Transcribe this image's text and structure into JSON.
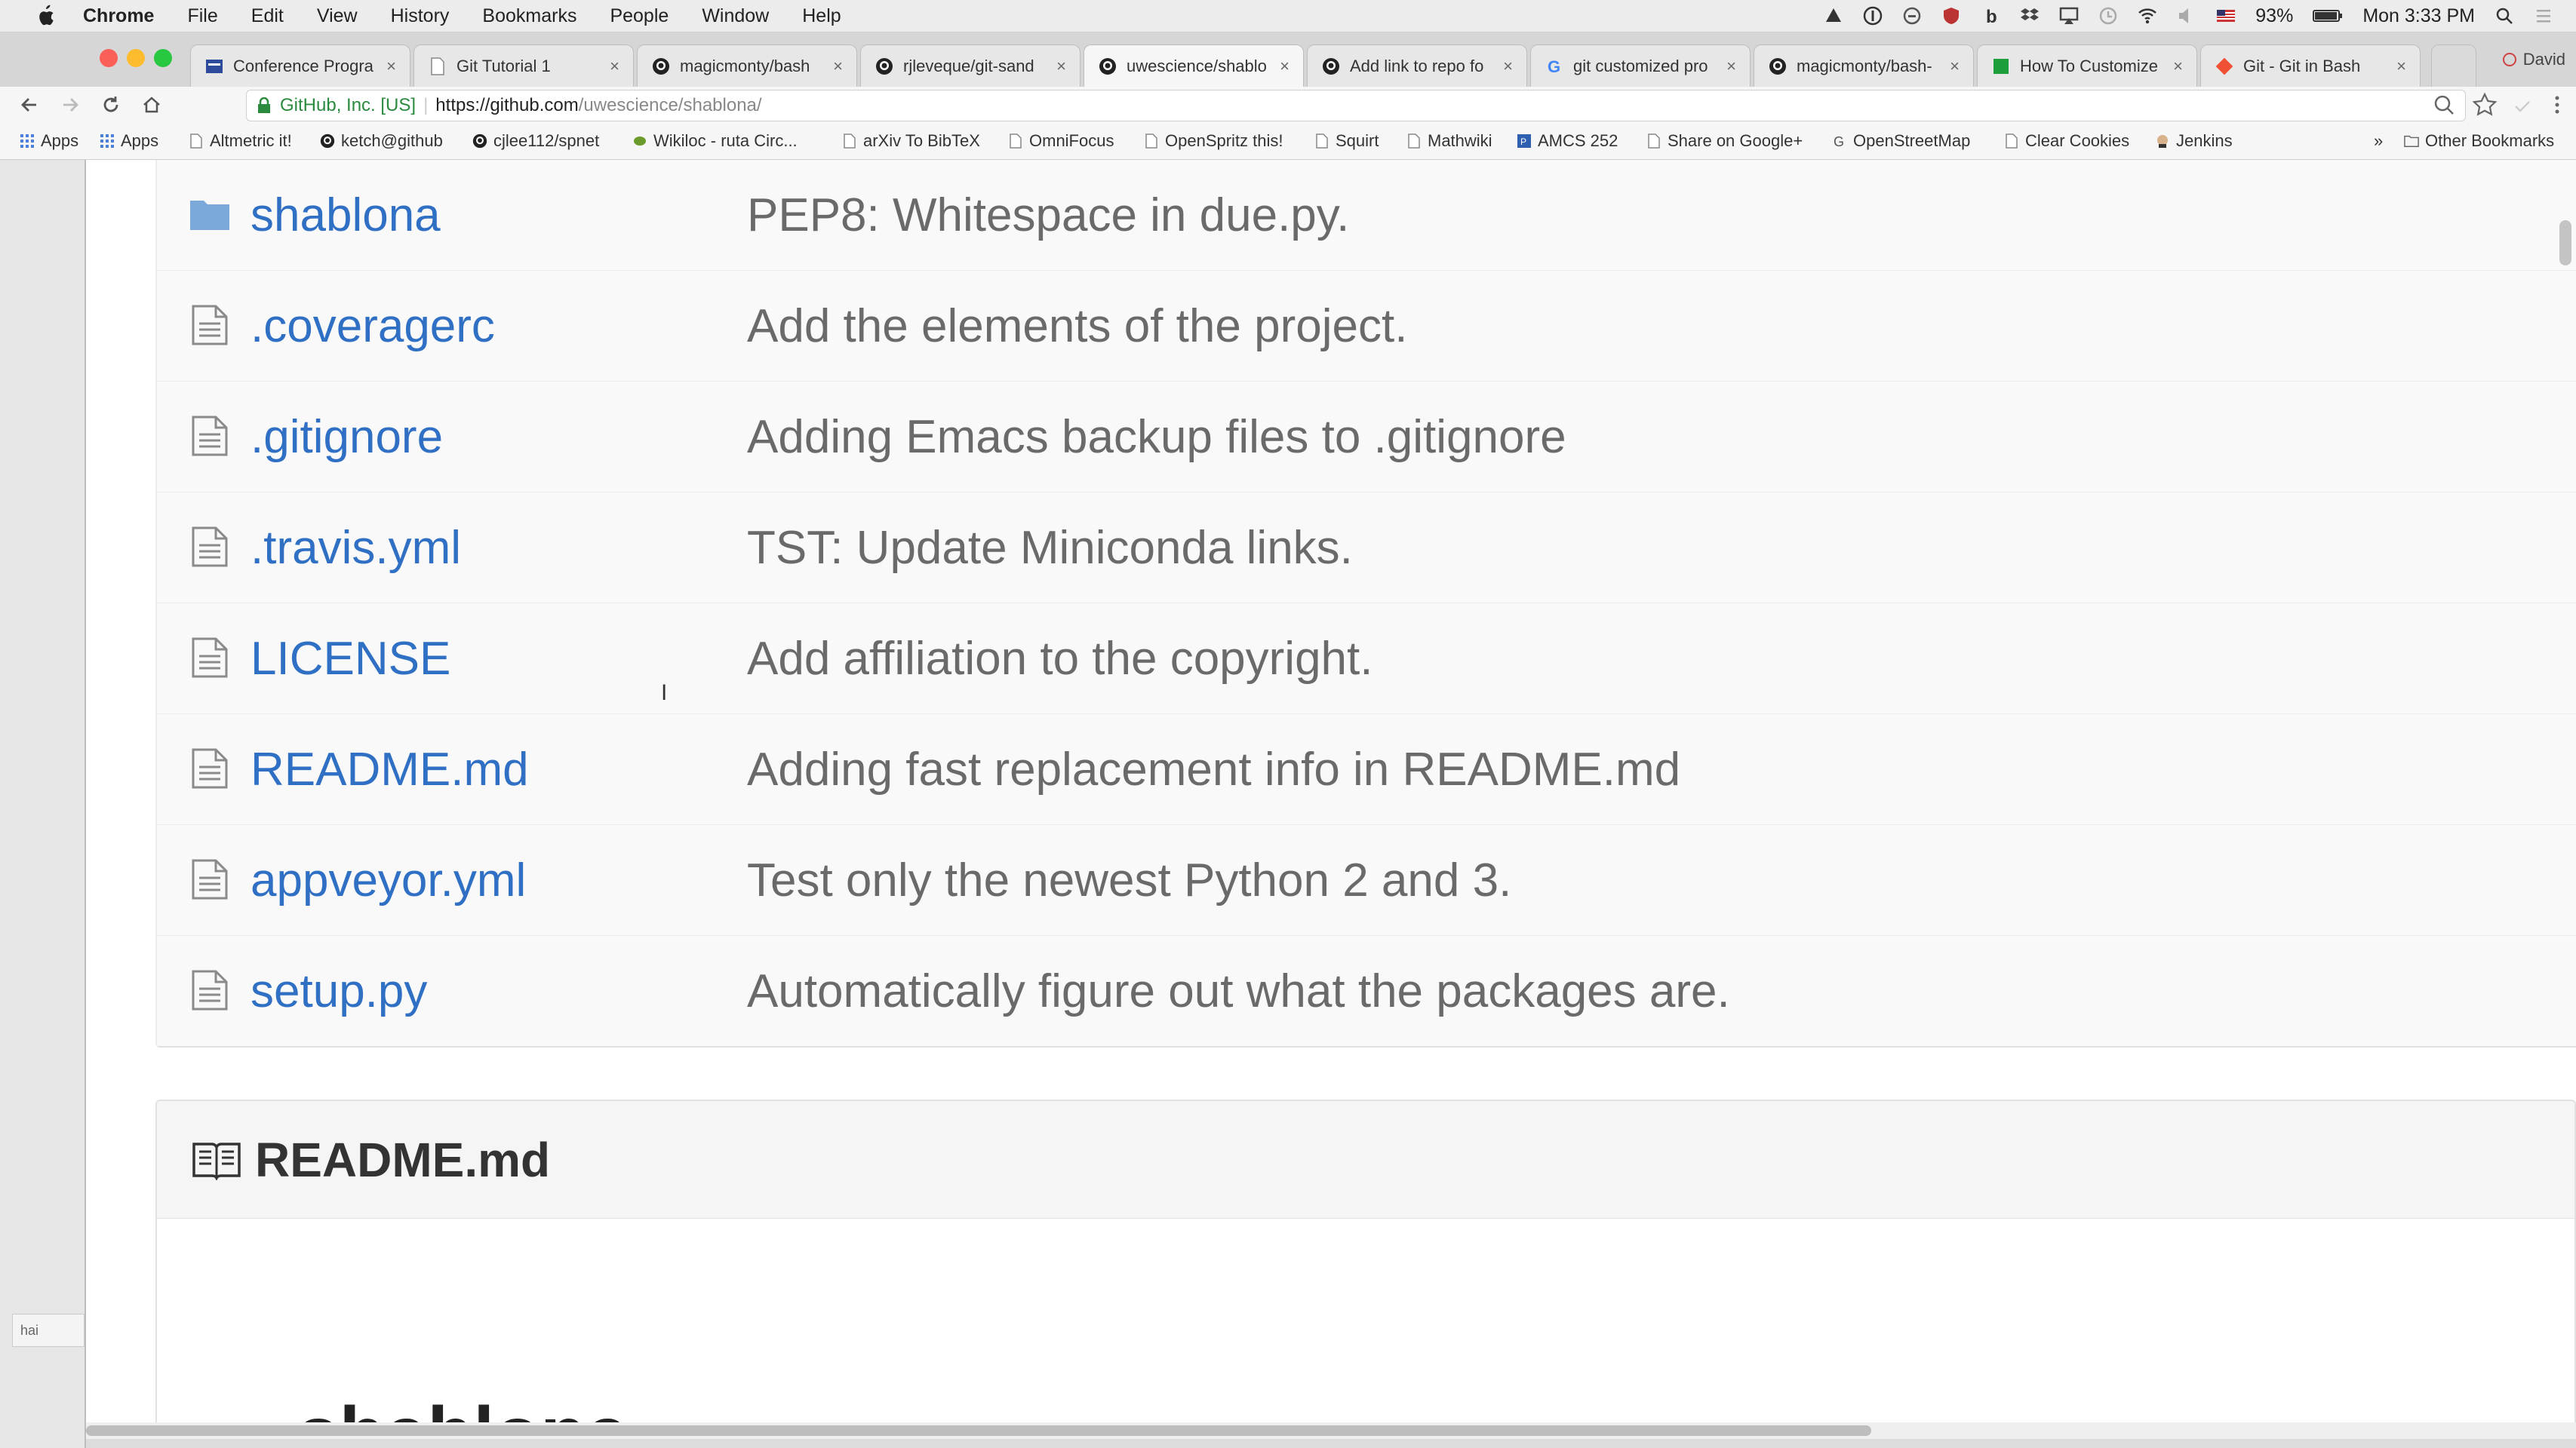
{
  "menubar": {
    "app_name": "Chrome",
    "items": [
      "File",
      "Edit",
      "View",
      "History",
      "Bookmarks",
      "People",
      "Window",
      "Help"
    ],
    "battery": "93%",
    "clock": "Mon 3:33 PM"
  },
  "tabs": [
    {
      "title": "Conference Progra",
      "favicon": "conference-icon"
    },
    {
      "title": "Git Tutorial 1",
      "favicon": "page-icon"
    },
    {
      "title": "magicmonty/bash",
      "favicon": "github-icon"
    },
    {
      "title": "rjleveque/git-sand",
      "favicon": "github-icon"
    },
    {
      "title": "uwescience/shablo",
      "favicon": "github-icon",
      "active": true
    },
    {
      "title": "Add link to repo fo",
      "favicon": "github-icon"
    },
    {
      "title": "git customized pro",
      "favicon": "google-icon"
    },
    {
      "title": "magicmonty/bash-",
      "favicon": "github-icon"
    },
    {
      "title": "How To Customize",
      "favicon": "green-square-icon"
    },
    {
      "title": "Git - Git in Bash",
      "favicon": "git-icon"
    }
  ],
  "profile_name": "David",
  "address": {
    "org": "GitHub, Inc. [US]",
    "url_host": "https://github.com",
    "url_path": "/uwescience/shablona/"
  },
  "bookmarks": {
    "apps_label": "Apps",
    "items": [
      "Apps",
      "Altmetric it!",
      "ketch@github",
      "cjlee112/spnet",
      "Wikiloc - ruta Circ...",
      "arXiv To BibTeX",
      "OmniFocus",
      "OpenSpritz this!",
      "Squirt",
      "Mathwiki",
      "AMCS 252",
      "Share on Google+",
      "OpenStreetMap",
      "Clear Cookies",
      "Jenkins"
    ],
    "overflow": "»",
    "other": "Other Bookmarks"
  },
  "sidebar_chip": "hai",
  "files": [
    {
      "name": "shablona",
      "type": "folder",
      "message": "PEP8: Whitespace in due.py."
    },
    {
      "name": ".coveragerc",
      "type": "file",
      "message": "Add the elements of the project."
    },
    {
      "name": ".gitignore",
      "type": "file",
      "message": "Adding Emacs backup files to .gitignore"
    },
    {
      "name": ".travis.yml",
      "type": "file",
      "message": "TST: Update Miniconda links."
    },
    {
      "name": "LICENSE",
      "type": "file",
      "message": "Add affiliation to the copyright."
    },
    {
      "name": "README.md",
      "type": "file",
      "message": "Adding fast replacement info in README.md"
    },
    {
      "name": "appveyor.yml",
      "type": "file",
      "message": "Test only the newest Python 2 and 3."
    },
    {
      "name": "setup.py",
      "type": "file",
      "message": "Automatically figure out what the packages are."
    }
  ],
  "readme": {
    "header": "README.md",
    "heading": "shablona"
  },
  "colors": {
    "link": "#2f6fc4",
    "message": "#6a6a6a",
    "folder": "#7ba9d9"
  }
}
